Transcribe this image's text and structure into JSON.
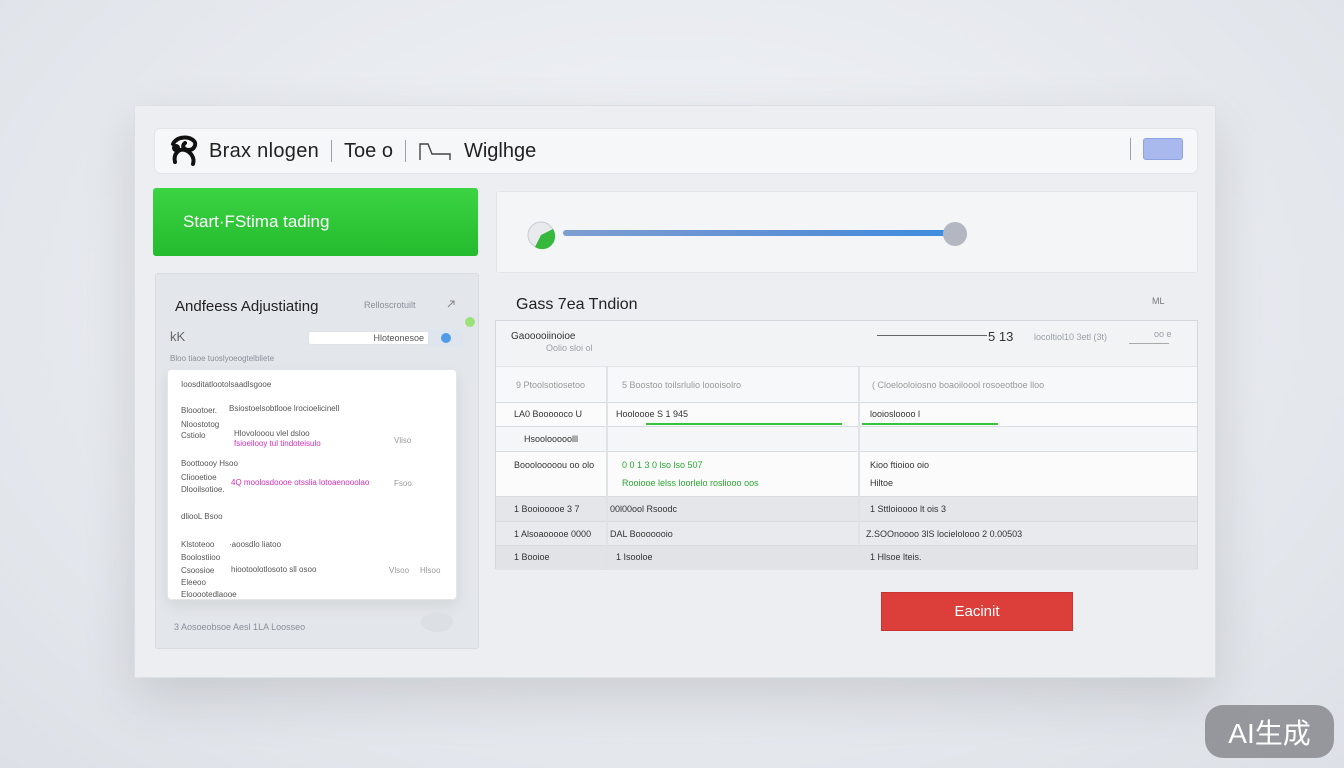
{
  "header": {
    "title": "Brax nlogen",
    "item1": "Toe o",
    "item2": "Wiglhge"
  },
  "start_button": {
    "label": "Start·FStima tading"
  },
  "progress": {
    "value": 0.97
  },
  "left_panel": {
    "title": "Andfeess Adjustiating",
    "hint": "Relloscrotuilt",
    "key_label": "kK",
    "input_value": "Hloteonesoe",
    "sub_label": "Bloo tiaoe tuoslyoeogtelbliete",
    "dialog": {
      "title": "Ioosditatlootolsaadlsgooe",
      "l1": "Bloootoer.",
      "v1": "Bsiostoelsobtlooe lrocioelicinell",
      "l2": "Nloostotog",
      "l3": "Cstiolo",
      "v3": "Hlovolooou vlel dsloo",
      "v3b": "fsioeilooy tul tindoteisulo",
      "s1": "Vliso",
      "l4": "Boottoooy Hsoo",
      "l5": "Cliooetioe",
      "v5": "4Q moolosdoooe otsslia lotoaenooolao",
      "s2": "Fsoo",
      "l6": "Dlooilsotioe.",
      "l7": "dliooL  Bsoo",
      "l8": "Klstoteoo",
      "v8": "·aoosdlo liatoo",
      "l9": "Boolostiioo",
      "l10": "Csoosioe",
      "v10": "hiootoolotlosoto sll osoo",
      "s3": "Vlsoo",
      "s4": "Hlsoo",
      "l11": "Eleeoo",
      "l12": "Elooootedlaooe"
    },
    "footer": "3  Aosoeobsoe  Aesl 1LA  Loosseo"
  },
  "right_panel": {
    "title": "Gass 7ea Tndion",
    "corner": "ML",
    "table_title": "Gaooooiinoioe",
    "table_sub": "Oolio    sloi ol",
    "table_num": "5  13",
    "table_right": "locoltiol10 3etl (3t)",
    "table_right2": "oo e",
    "col_headers": [
      "9 Ptoolsotiosetoo",
      "5 Boostoo toilsrlulio   loooisolro",
      "( Cloelooloiosno  boaoiloool   rosoeotboe   lloo"
    ],
    "rows": [
      [
        "LA0 Boooooco U",
        "Hooloooe  S   1 945",
        "looiosloooo l"
      ],
      [
        "Hsoolooooolll",
        "",
        ""
      ],
      [
        "Booolooooou oo olo",
        "0 0 1 3 0 lso lso 507",
        "Kioo  ftioioo oio"
      ],
      [
        "",
        "Rooiooe lelss loorlelo rosliooo   oos",
        "Hiltoe"
      ],
      [
        "1   Booiooooe  3 7",
        "00l00ool   Rsoodc",
        "1 Sttloioooo  lt ois 3"
      ],
      [
        "1   Alsoaooooe 0000",
        "DAL Booooooio",
        "Z.SOOnoooo 3lS locielolooo 2 0.00503"
      ],
      [
        "1   Booioe",
        "1    Isooloe",
        "1  Hlsoe lteis."
      ]
    ]
  },
  "exit_button": {
    "label": "Eacinit"
  },
  "badge": {
    "label": "AI生成"
  }
}
